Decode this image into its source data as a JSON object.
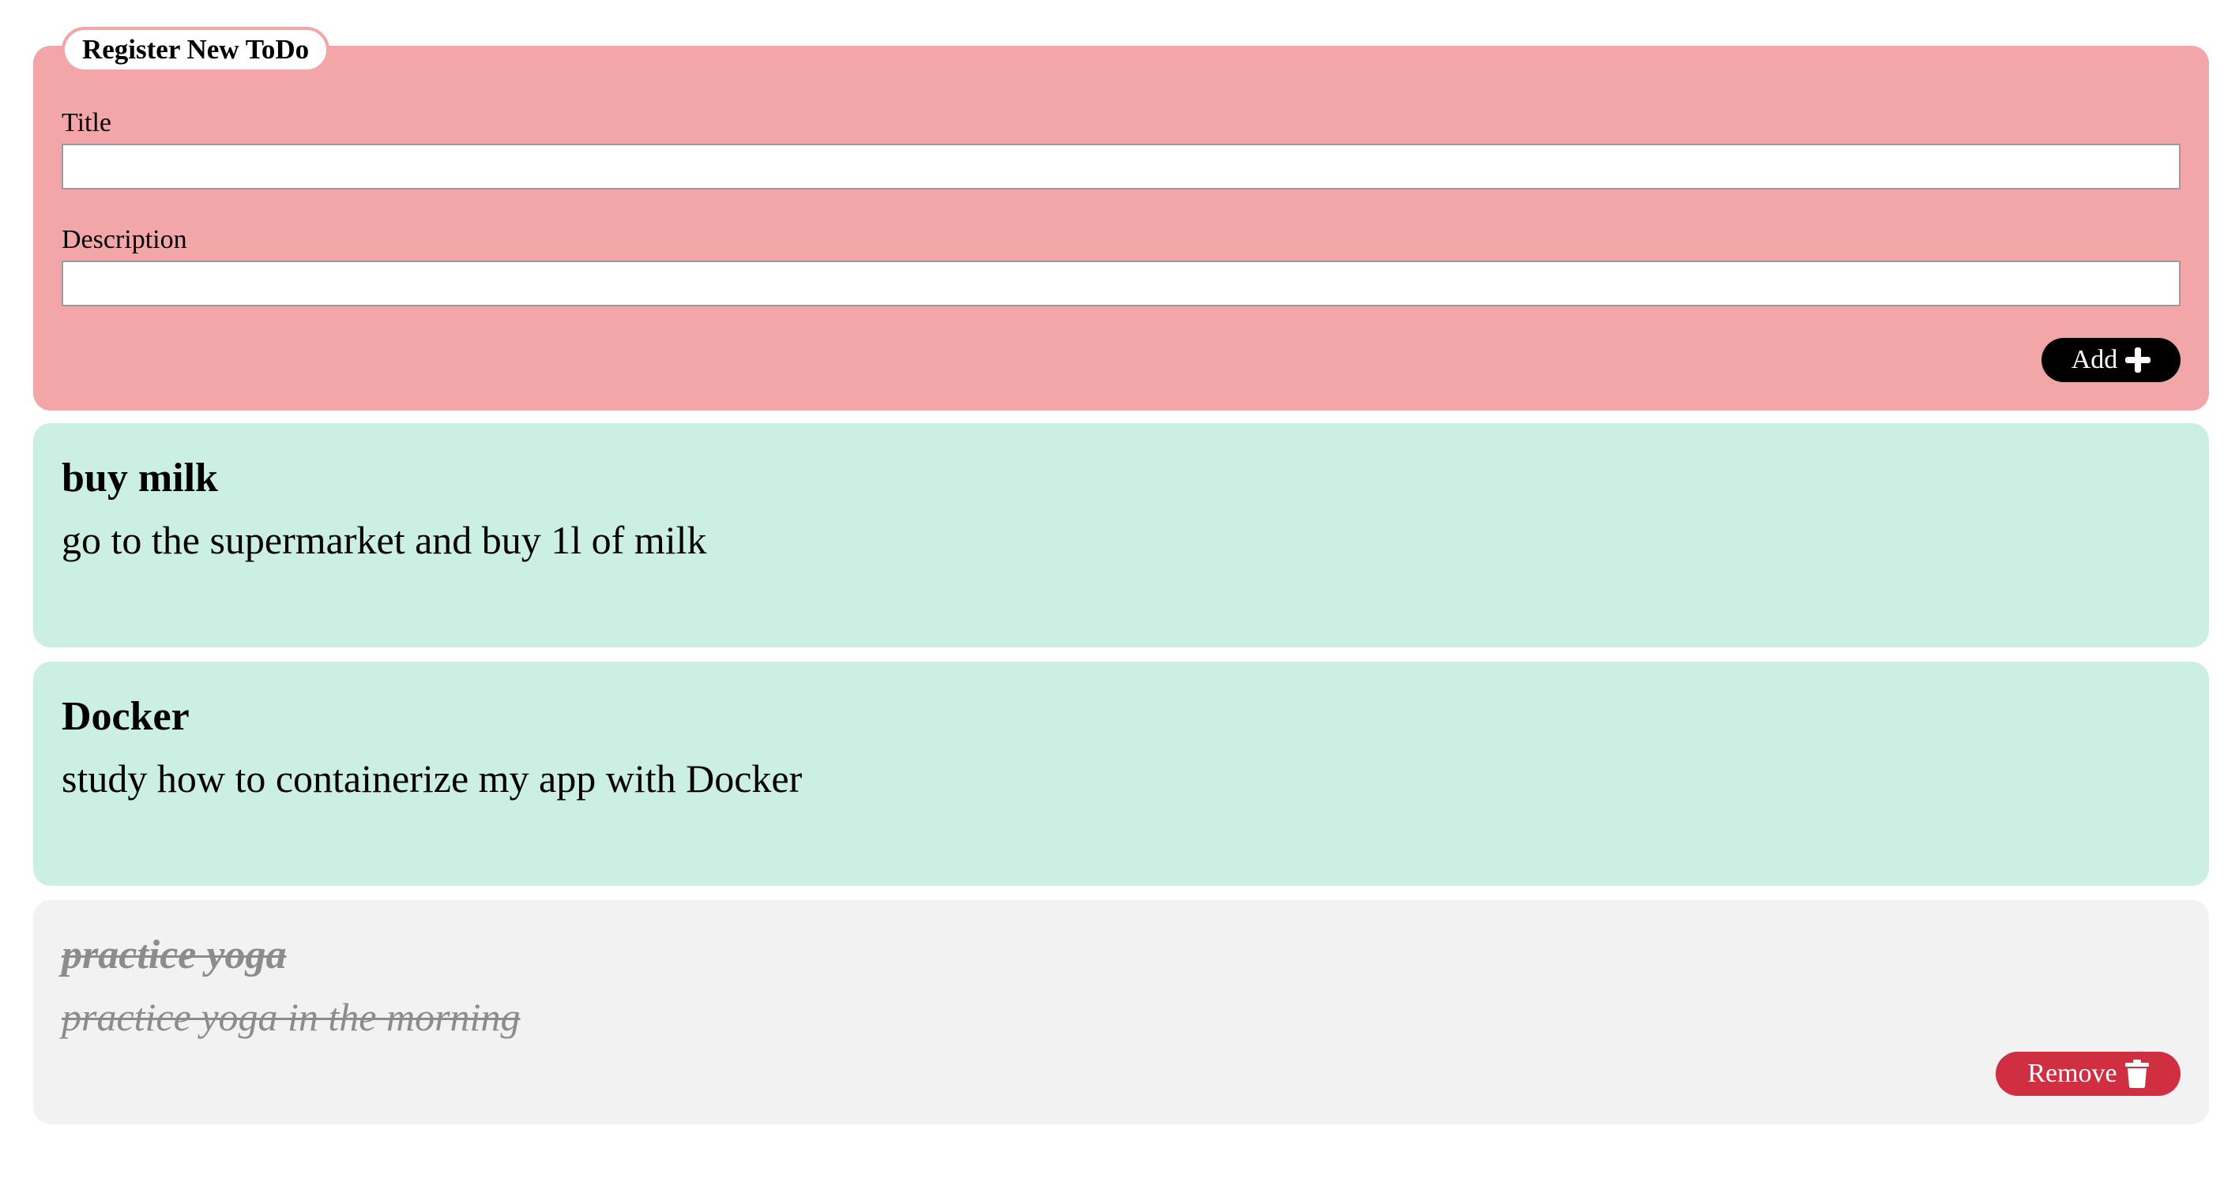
{
  "form": {
    "legend": "Register New ToDo",
    "title_label": "Title",
    "title_value": "",
    "description_label": "Description",
    "description_value": "",
    "add_label": "Add",
    "add_icon": "plus-icon"
  },
  "todos": [
    {
      "title": "buy milk",
      "description": "go to the supermarket and buy 1l of milk",
      "completed": false
    },
    {
      "title": "Docker",
      "description": "study how to containerize my app with Docker",
      "completed": false
    },
    {
      "title": "practice yoga",
      "description": "practice yoga in the morning",
      "completed": true,
      "remove_label": "Remove",
      "remove_icon": "trash-icon"
    }
  ],
  "colors": {
    "form_background": "#f2a6a8",
    "active_card": "#cbefe3",
    "done_card": "#f2f2f2",
    "add_button": "#000000",
    "remove_button": "#d02f42",
    "done_text": "#8c8c8c"
  }
}
